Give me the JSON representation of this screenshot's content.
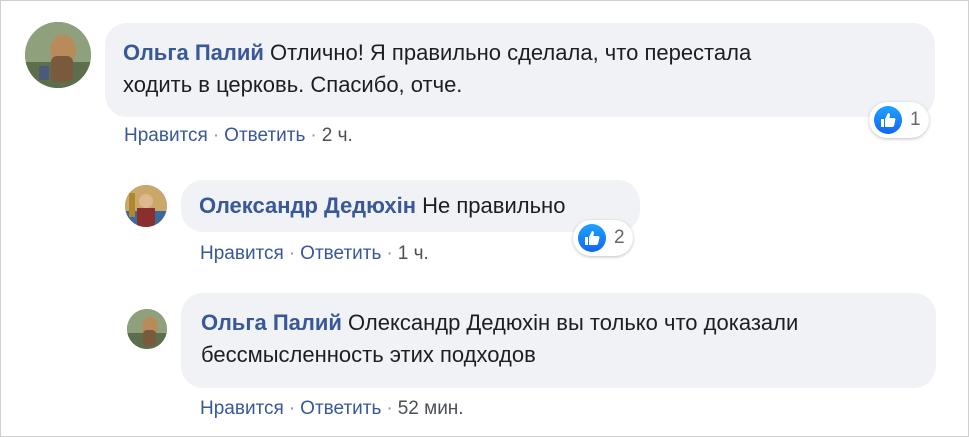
{
  "comments": [
    {
      "author": "Ольга Палий",
      "text_line1": "Отлично! Я правильно сделала, что перестала",
      "text_line2": "ходить в церковь. Спасибо, отче.",
      "like_label": "Нравится",
      "reply_label": "Ответить",
      "time": "2 ч.",
      "reaction_count": "1",
      "reaction_icon": "like-icon"
    },
    {
      "author": "Олександр Дедюхін",
      "text_line1": "Не правильно",
      "like_label": "Нравится",
      "reply_label": "Ответить",
      "time": "1 ч.",
      "reaction_count": "2",
      "reaction_icon": "like-icon"
    },
    {
      "author": "Ольга Палий",
      "text_line1": "Олександр Дедюхін вы только что доказали",
      "text_line2": "бессмысленность этих подходов",
      "like_label": "Нравится",
      "reply_label": "Ответить",
      "time": "52 мин."
    }
  ],
  "separator": "·",
  "colors": {
    "author": "#385898",
    "bubble": "#f0f2f5",
    "like": "#1877f2",
    "meta": "#4b4f56"
  }
}
